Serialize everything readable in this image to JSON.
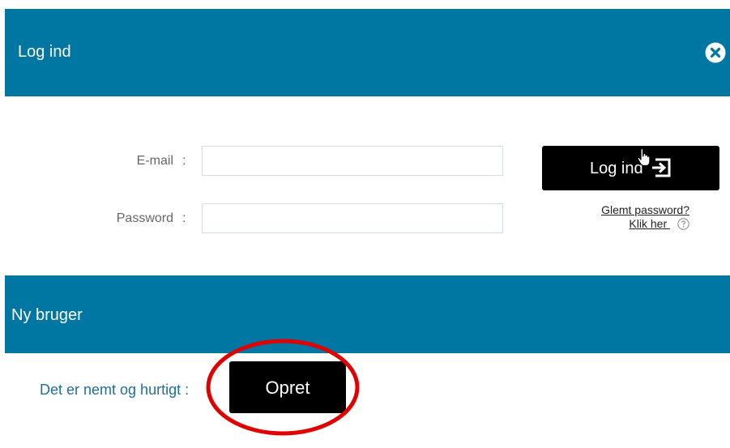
{
  "login_header": {
    "title": "Log ind"
  },
  "form": {
    "email_label": "E-mail",
    "password_label": "Password",
    "separator": ":",
    "email_value": "",
    "password_value": "",
    "login_button_label": "Log ind"
  },
  "help": {
    "forgot_password": "Glemt password?",
    "click_here": "Klik her "
  },
  "new_user": {
    "title": "Ny bruger",
    "description": "Det er nemt og hurtigt :",
    "create_button_label": "Opret"
  },
  "colors": {
    "header_blue": "#0077a3",
    "button_black": "#000000",
    "annotation_red": "#e00000",
    "link_blue": "#1f6f9a"
  },
  "icons": {
    "close": "close-circle-icon",
    "login": "login-arrow-icon",
    "cursor": "hand-pointer-icon",
    "help": "question-circle-icon"
  }
}
